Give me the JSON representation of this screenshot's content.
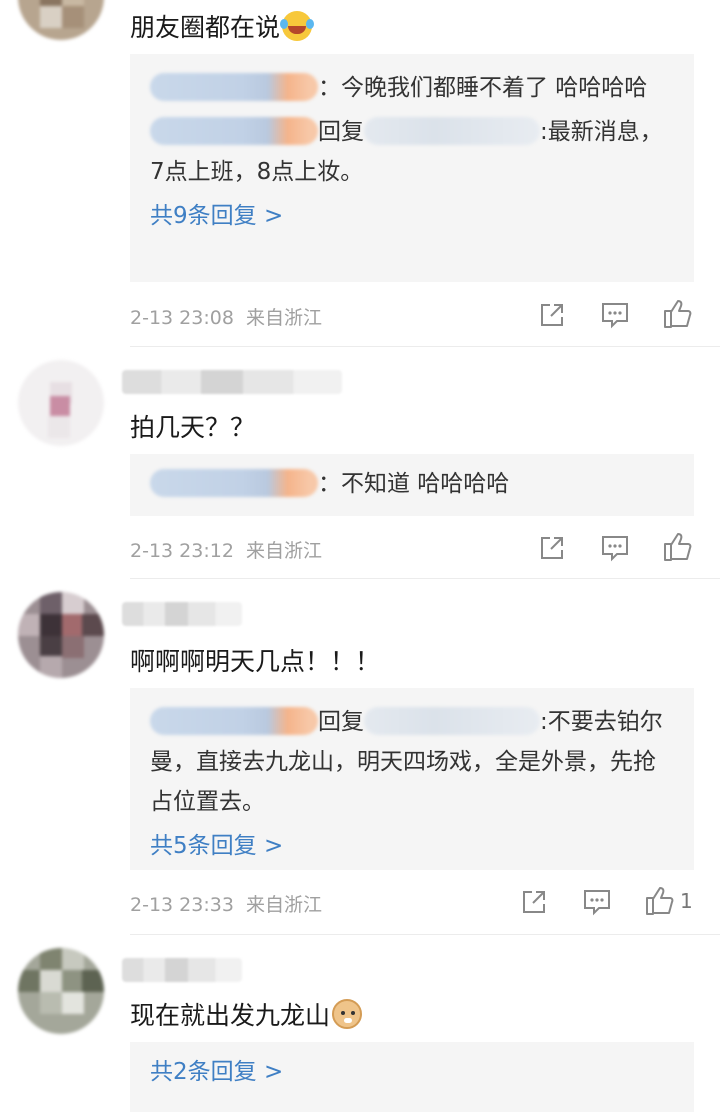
{
  "comments": [
    {
      "text": "朋友圈都在说",
      "emoji": "laughing-tears-emoji",
      "replies": [
        {
          "type": "inline",
          "text": "：今晚我们都睡不着了 哈哈哈哈"
        },
        {
          "type": "reply",
          "reply_word": "回复",
          "text": ":最新消息，7点上班，8点上妆。"
        }
      ],
      "more_replies": "共9条回复 >",
      "time": "2-13 23:08",
      "location": "来自浙江",
      "like_count": ""
    },
    {
      "text": "拍几天？？",
      "replies": [
        {
          "type": "inline",
          "text": "：不知道 哈哈哈哈"
        }
      ],
      "more_replies": "",
      "time": "2-13 23:12",
      "location": "来自浙江",
      "like_count": ""
    },
    {
      "text": "啊啊啊明天几点！！！",
      "replies": [
        {
          "type": "reply",
          "reply_word": "回复",
          "text": ":不要去铂尔曼，直接去九龙山，明天四场戏，全是外景，先抢占位置去。"
        }
      ],
      "more_replies": "共5条回复 >",
      "time": "2-13 23:33",
      "location": "来自浙江",
      "like_count": "1"
    },
    {
      "text": "现在就出发九龙山",
      "emoji": "doge-emoji",
      "replies": [],
      "more_replies": "共2条回复 >",
      "time": "",
      "location": "",
      "like_count": ""
    }
  ],
  "icons": {
    "share": "share-icon",
    "comment": "comment-icon",
    "like": "like-icon"
  },
  "colors": {
    "link": "#3f7fc4",
    "reply_box": "#f5f5f5",
    "meta_text": "#a0a0a0"
  }
}
